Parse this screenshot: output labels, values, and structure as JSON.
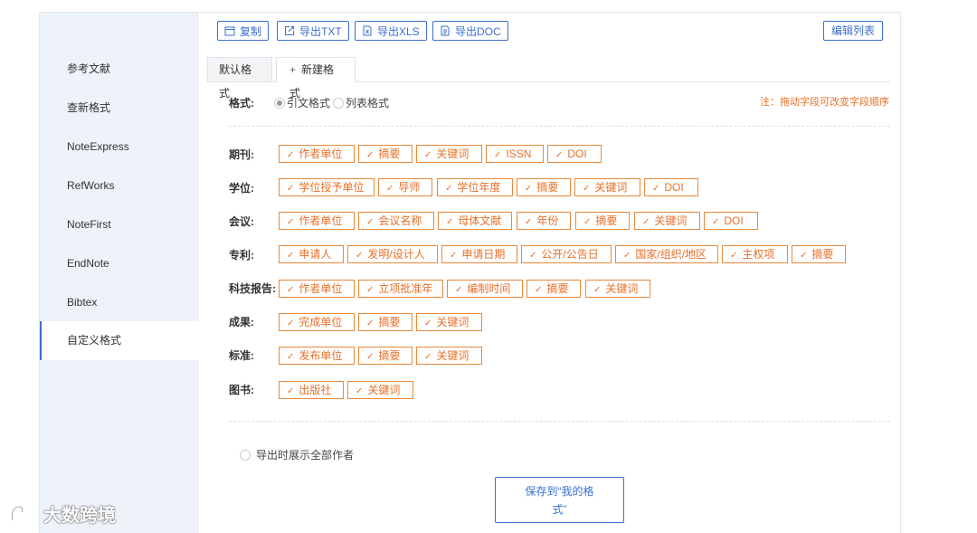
{
  "sidebar": {
    "items": [
      {
        "label": "参考文献"
      },
      {
        "label": "查新格式"
      },
      {
        "label": "NoteExpress"
      },
      {
        "label": "RefWorks"
      },
      {
        "label": "NoteFirst"
      },
      {
        "label": "EndNote"
      },
      {
        "label": "Bibtex"
      },
      {
        "label": "自定义格式",
        "active": true
      }
    ]
  },
  "toolbar": {
    "copy": "复制",
    "export_txt": "导出TXT",
    "export_xls": "导出XLS",
    "export_doc": "导出DOC",
    "edit_list": "编辑列表"
  },
  "tabs": {
    "default": "默认格式",
    "new": "新建格式",
    "new_plus": "+"
  },
  "format": {
    "label": "格式:",
    "options": [
      "引文格式",
      "列表格式"
    ],
    "selected": "引文格式",
    "note": "注：拖动字段可改变字段顺序"
  },
  "rows": [
    {
      "label": "期刊:",
      "fields": [
        "作者单位",
        "摘要",
        "关键词",
        "ISSN",
        "DOI"
      ]
    },
    {
      "label": "学位:",
      "fields": [
        "学位授予单位",
        "导师",
        "学位年度",
        "摘要",
        "关键词",
        "DOI"
      ]
    },
    {
      "label": "会议:",
      "fields": [
        "作者单位",
        "会议名称",
        "母体文献",
        "年份",
        "摘要",
        "关键词",
        "DOI"
      ]
    },
    {
      "label": "专利:",
      "fields": [
        "申请人",
        "发明/设计人",
        "申请日期",
        "公开/公告日",
        "国家/组织/地区",
        "主权项",
        "摘要"
      ]
    },
    {
      "label": "科技报告:",
      "fields": [
        "作者单位",
        "立项批准年",
        "编制时间",
        "摘要",
        "关键词"
      ]
    },
    {
      "label": "成果:",
      "fields": [
        "完成单位",
        "摘要",
        "关键词"
      ]
    },
    {
      "label": "标准:",
      "fields": [
        "发布单位",
        "摘要",
        "关键词"
      ]
    },
    {
      "label": "图书:",
      "fields": [
        "出版社",
        "关键词"
      ]
    }
  ],
  "check_glyph": "✓",
  "export_option": "导出时展示全部作者",
  "save": {
    "line1": "保存到“我的格",
    "line2": "式”"
  },
  "watermark": "大数跨境",
  "colors": {
    "accent": "#3b6fd0",
    "chip": "#e8702a",
    "sidebar_bg": "#eef3fa"
  }
}
